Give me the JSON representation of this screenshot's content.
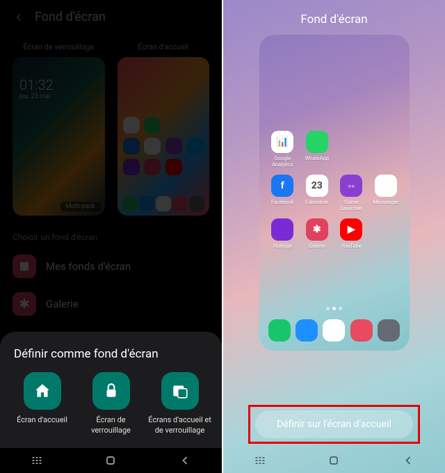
{
  "left": {
    "header_title": "Fond d'écran",
    "thumb_lock_label": "Écran de verrouillage",
    "thumb_home_label": "Écran d'accueil",
    "lock_time": "01:32",
    "lock_date": "jeu. 23 mai",
    "multipack_badge": "Multi-pack",
    "section_label": "Choisir un fond d'écran",
    "my_wallpapers": "Mes fonds d'écran",
    "gallery": "Galerie",
    "sheet_title": "Définir comme fond d'écran",
    "opt_home": "Écran d'accueil",
    "opt_lock": "Écran de\nverrouillage",
    "opt_both": "Écrans d'accueil et\nde verrouillage"
  },
  "right": {
    "title": "Fond d'écran",
    "apply_label": "Définir sur l'écran d'accueil",
    "apps": [
      {
        "name": "Google Analytics",
        "color": "#ffffff",
        "glyph": "📊"
      },
      {
        "name": "WhatsApp",
        "color": "#25d366",
        "glyph": ""
      },
      {
        "name": "Facebook",
        "color": "#1877f2",
        "glyph": "f"
      },
      {
        "name": "Calendrier",
        "color": "#ffffff",
        "glyph": "23"
      },
      {
        "name": "Game Launcher",
        "color": "#8a3fd1",
        "glyph": "◦◦"
      },
      {
        "name": "Messenger",
        "color": "#ffffff",
        "glyph": ""
      },
      {
        "name": "Horloge",
        "color": "#7a2bd4",
        "glyph": ""
      },
      {
        "name": "Galerie",
        "color": "#e0415f",
        "glyph": "✱"
      },
      {
        "name": "YouTube",
        "color": "#ff0000",
        "glyph": "▶"
      }
    ],
    "dock": [
      {
        "name": "phone",
        "color": "#19c56b"
      },
      {
        "name": "messages",
        "color": "#1f8fff"
      },
      {
        "name": "browser",
        "color": "#ffffff"
      },
      {
        "name": "camera",
        "color": "#e84a5f"
      },
      {
        "name": "apps",
        "color": "#666a73"
      }
    ]
  }
}
